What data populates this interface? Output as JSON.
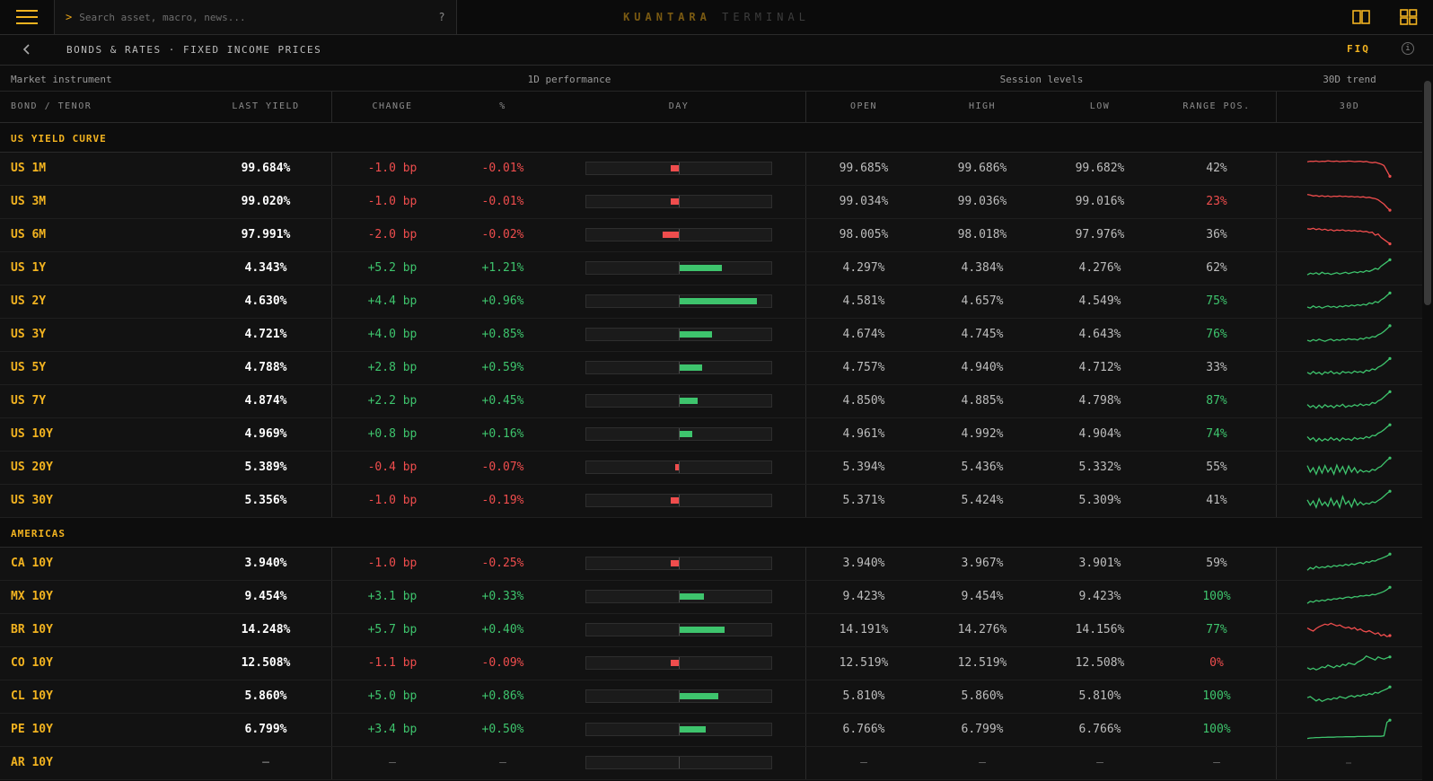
{
  "app": {
    "brand_primary": "KUANTARA",
    "brand_secondary": "TERMINAL",
    "search_placeholder": "Search asset, macro, news...",
    "search_prompt": ">",
    "help_label": "?",
    "breadcrumb": "BONDS & RATES · FIXED INCOME PRICES",
    "function_code": "FIQ",
    "accent_color": "#f2b320"
  },
  "table": {
    "group_headers": [
      "Market instrument",
      "1D performance",
      "Session levels",
      "30D trend"
    ],
    "columns": [
      "BOND / TENOR",
      "LAST YIELD",
      "CHANGE",
      "%",
      "DAY",
      "OPEN",
      "HIGH",
      "LOW",
      "RANGE POS.",
      "30D"
    ],
    "sections": [
      {
        "title": "US YIELD CURVE",
        "rows": [
          {
            "name": "US 1M",
            "last": "99.684%",
            "change": "-1.0 bp",
            "pct": "-0.01%",
            "day": -0.05,
            "open": "99.685%",
            "high": "99.686%",
            "low": "99.682%",
            "range": "42%",
            "range_tone": "neutral",
            "trend": "down",
            "spark": [
              0.82,
              0.85,
              0.84,
              0.86,
              0.83,
              0.85,
              0.84,
              0.87,
              0.85,
              0.84,
              0.86,
              0.83,
              0.85,
              0.84,
              0.86,
              0.85,
              0.83,
              0.84,
              0.85,
              0.82,
              0.84,
              0.8,
              0.78,
              0.8,
              0.76,
              0.72,
              0.65,
              0.4,
              0.15
            ]
          },
          {
            "name": "US 3M",
            "last": "99.020%",
            "change": "-1.0 bp",
            "pct": "-0.01%",
            "day": -0.05,
            "open": "99.034%",
            "high": "99.036%",
            "low": "99.016%",
            "range": "23%",
            "range_tone": "neg",
            "trend": "down",
            "spark": [
              0.85,
              0.82,
              0.78,
              0.8,
              0.76,
              0.79,
              0.75,
              0.78,
              0.74,
              0.77,
              0.76,
              0.78,
              0.75,
              0.77,
              0.74,
              0.76,
              0.73,
              0.75,
              0.72,
              0.74,
              0.7,
              0.72,
              0.68,
              0.66,
              0.6,
              0.5,
              0.4,
              0.25,
              0.12
            ]
          },
          {
            "name": "US 6M",
            "last": "97.991%",
            "change": "-2.0 bp",
            "pct": "-0.02%",
            "day": -0.1,
            "open": "98.005%",
            "high": "98.018%",
            "low": "97.976%",
            "range": "36%",
            "range_tone": "neutral",
            "trend": "down",
            "spark": [
              0.8,
              0.78,
              0.82,
              0.76,
              0.8,
              0.74,
              0.78,
              0.72,
              0.76,
              0.7,
              0.74,
              0.72,
              0.75,
              0.7,
              0.73,
              0.69,
              0.72,
              0.68,
              0.7,
              0.66,
              0.68,
              0.62,
              0.64,
              0.5,
              0.56,
              0.4,
              0.3,
              0.2,
              0.1
            ]
          },
          {
            "name": "US 1Y",
            "last": "4.343%",
            "change": "+5.2 bp",
            "pct": "+1.21%",
            "day": 0.26,
            "open": "4.297%",
            "high": "4.384%",
            "low": "4.276%",
            "range": "62%",
            "range_tone": "neutral",
            "trend": "up",
            "spark": [
              0.2,
              0.28,
              0.24,
              0.3,
              0.22,
              0.32,
              0.25,
              0.28,
              0.22,
              0.26,
              0.3,
              0.24,
              0.28,
              0.32,
              0.26,
              0.3,
              0.34,
              0.3,
              0.36,
              0.32,
              0.4,
              0.36,
              0.42,
              0.5,
              0.46,
              0.6,
              0.7,
              0.8,
              0.9
            ]
          },
          {
            "name": "US 2Y",
            "last": "4.630%",
            "change": "+4.4 bp",
            "pct": "+0.96%",
            "day": 0.48,
            "open": "4.581%",
            "high": "4.657%",
            "low": "4.549%",
            "range": "75%",
            "range_tone": "pos",
            "trend": "up",
            "spark": [
              0.25,
              0.2,
              0.3,
              0.22,
              0.28,
              0.2,
              0.26,
              0.3,
              0.24,
              0.28,
              0.22,
              0.3,
              0.26,
              0.32,
              0.28,
              0.34,
              0.3,
              0.36,
              0.32,
              0.38,
              0.34,
              0.44,
              0.4,
              0.5,
              0.46,
              0.58,
              0.66,
              0.78,
              0.9
            ]
          },
          {
            "name": "US 3Y",
            "last": "4.721%",
            "change": "+4.0 bp",
            "pct": "+0.85%",
            "day": 0.2,
            "open": "4.674%",
            "high": "4.745%",
            "low": "4.643%",
            "range": "76%",
            "range_tone": "pos",
            "trend": "up",
            "spark": [
              0.25,
              0.2,
              0.28,
              0.22,
              0.3,
              0.24,
              0.2,
              0.26,
              0.3,
              0.22,
              0.28,
              0.24,
              0.3,
              0.26,
              0.32,
              0.28,
              0.3,
              0.26,
              0.34,
              0.3,
              0.38,
              0.34,
              0.42,
              0.4,
              0.5,
              0.56,
              0.66,
              0.78,
              0.92
            ]
          },
          {
            "name": "US 5Y",
            "last": "4.788%",
            "change": "+2.8 bp",
            "pct": "+0.59%",
            "day": 0.14,
            "open": "4.757%",
            "high": "4.940%",
            "low": "4.712%",
            "range": "33%",
            "range_tone": "neutral",
            "trend": "up",
            "spark": [
              0.3,
              0.22,
              0.34,
              0.24,
              0.3,
              0.2,
              0.32,
              0.26,
              0.36,
              0.24,
              0.3,
              0.22,
              0.34,
              0.28,
              0.32,
              0.26,
              0.36,
              0.3,
              0.34,
              0.28,
              0.4,
              0.36,
              0.46,
              0.42,
              0.54,
              0.6,
              0.7,
              0.82,
              0.94
            ]
          },
          {
            "name": "US 7Y",
            "last": "4.874%",
            "change": "+2.2 bp",
            "pct": "+0.45%",
            "day": 0.11,
            "open": "4.850%",
            "high": "4.885%",
            "low": "4.798%",
            "range": "87%",
            "range_tone": "pos",
            "trend": "up",
            "spark": [
              0.35,
              0.22,
              0.3,
              0.18,
              0.32,
              0.2,
              0.34,
              0.24,
              0.3,
              0.2,
              0.32,
              0.26,
              0.36,
              0.22,
              0.3,
              0.26,
              0.34,
              0.28,
              0.38,
              0.3,
              0.36,
              0.32,
              0.44,
              0.4,
              0.52,
              0.58,
              0.7,
              0.82,
              0.94
            ]
          },
          {
            "name": "US 10Y",
            "last": "4.969%",
            "change": "+0.8 bp",
            "pct": "+0.16%",
            "day": 0.08,
            "open": "4.961%",
            "high": "4.992%",
            "low": "4.904%",
            "range": "74%",
            "range_tone": "pos",
            "trend": "up",
            "spark": [
              0.4,
              0.25,
              0.35,
              0.18,
              0.32,
              0.2,
              0.3,
              0.22,
              0.36,
              0.24,
              0.32,
              0.2,
              0.34,
              0.26,
              0.3,
              0.22,
              0.36,
              0.28,
              0.34,
              0.3,
              0.4,
              0.34,
              0.46,
              0.44,
              0.56,
              0.62,
              0.72,
              0.84,
              0.95
            ]
          },
          {
            "name": "US 20Y",
            "last": "5.389%",
            "change": "-0.4 bp",
            "pct": "-0.07%",
            "day": -0.02,
            "open": "5.394%",
            "high": "5.436%",
            "low": "5.332%",
            "range": "55%",
            "range_tone": "neutral",
            "trend": "up",
            "spark": [
              0.6,
              0.3,
              0.5,
              0.2,
              0.55,
              0.25,
              0.6,
              0.3,
              0.5,
              0.2,
              0.62,
              0.3,
              0.55,
              0.22,
              0.58,
              0.3,
              0.5,
              0.26,
              0.4,
              0.3,
              0.36,
              0.3,
              0.42,
              0.38,
              0.5,
              0.56,
              0.7,
              0.84,
              0.95
            ]
          },
          {
            "name": "US 30Y",
            "last": "5.356%",
            "change": "-1.0 bp",
            "pct": "-0.19%",
            "day": -0.05,
            "open": "5.371%",
            "high": "5.424%",
            "low": "5.309%",
            "range": "41%",
            "range_tone": "neutral",
            "trend": "up",
            "spark": [
              0.55,
              0.3,
              0.5,
              0.2,
              0.6,
              0.3,
              0.45,
              0.25,
              0.62,
              0.3,
              0.52,
              0.2,
              0.7,
              0.35,
              0.5,
              0.22,
              0.58,
              0.3,
              0.45,
              0.32,
              0.4,
              0.36,
              0.46,
              0.42,
              0.52,
              0.6,
              0.72,
              0.84,
              0.95
            ]
          }
        ]
      },
      {
        "title": "AMERICAS",
        "rows": [
          {
            "name": "CA 10Y",
            "last": "3.940%",
            "change": "-1.0 bp",
            "pct": "-0.25%",
            "day": -0.05,
            "open": "3.940%",
            "high": "3.967%",
            "low": "3.901%",
            "range": "59%",
            "range_tone": "neutral",
            "trend": "up",
            "spark": [
              0.2,
              0.32,
              0.26,
              0.38,
              0.3,
              0.36,
              0.32,
              0.4,
              0.34,
              0.42,
              0.38,
              0.44,
              0.4,
              0.48,
              0.42,
              0.5,
              0.46,
              0.52,
              0.56,
              0.5,
              0.6,
              0.56,
              0.64,
              0.62,
              0.7,
              0.74,
              0.8,
              0.86,
              0.95
            ]
          },
          {
            "name": "MX 10Y",
            "last": "9.454%",
            "change": "+3.1 bp",
            "pct": "+0.33%",
            "day": 0.15,
            "open": "9.423%",
            "high": "9.454%",
            "low": "9.423%",
            "range": "100%",
            "range_tone": "pos",
            "trend": "up",
            "spark": [
              0.2,
              0.3,
              0.26,
              0.34,
              0.3,
              0.36,
              0.32,
              0.4,
              0.36,
              0.42,
              0.4,
              0.46,
              0.42,
              0.48,
              0.5,
              0.46,
              0.52,
              0.5,
              0.56,
              0.54,
              0.58,
              0.56,
              0.62,
              0.6,
              0.66,
              0.7,
              0.76,
              0.84,
              0.95
            ]
          },
          {
            "name": "BR 10Y",
            "last": "14.248%",
            "change": "+5.7 bp",
            "pct": "+0.40%",
            "day": 0.28,
            "open": "14.191%",
            "high": "14.276%",
            "low": "14.156%",
            "range": "77%",
            "range_tone": "pos",
            "trend": "down",
            "spark": [
              0.6,
              0.52,
              0.46,
              0.58,
              0.66,
              0.72,
              0.78,
              0.74,
              0.82,
              0.76,
              0.7,
              0.74,
              0.66,
              0.6,
              0.64,
              0.56,
              0.62,
              0.5,
              0.56,
              0.46,
              0.42,
              0.48,
              0.4,
              0.32,
              0.38,
              0.24,
              0.3,
              0.2,
              0.25
            ]
          },
          {
            "name": "CO 10Y",
            "last": "12.508%",
            "change": "-1.1 bp",
            "pct": "-0.09%",
            "day": -0.05,
            "open": "12.519%",
            "high": "12.519%",
            "low": "12.508%",
            "range": "0%",
            "range_tone": "neg",
            "trend": "up",
            "spark": [
              0.3,
              0.22,
              0.28,
              0.2,
              0.26,
              0.34,
              0.3,
              0.42,
              0.36,
              0.3,
              0.4,
              0.34,
              0.46,
              0.4,
              0.52,
              0.48,
              0.44,
              0.56,
              0.62,
              0.7,
              0.84,
              0.78,
              0.72,
              0.66,
              0.8,
              0.74,
              0.7,
              0.76,
              0.8
            ]
          },
          {
            "name": "CL 10Y",
            "last": "5.860%",
            "change": "+5.0 bp",
            "pct": "+0.86%",
            "day": 0.24,
            "open": "5.810%",
            "high": "5.860%",
            "low": "5.810%",
            "range": "100%",
            "range_tone": "pos",
            "trend": "up",
            "spark": [
              0.45,
              0.5,
              0.4,
              0.3,
              0.38,
              0.28,
              0.34,
              0.4,
              0.36,
              0.44,
              0.4,
              0.5,
              0.46,
              0.42,
              0.5,
              0.54,
              0.48,
              0.56,
              0.52,
              0.6,
              0.56,
              0.64,
              0.6,
              0.7,
              0.66,
              0.74,
              0.8,
              0.86,
              0.95
            ]
          },
          {
            "name": "PE 10Y",
            "last": "6.799%",
            "change": "+3.4 bp",
            "pct": "+0.50%",
            "day": 0.16,
            "open": "6.766%",
            "high": "6.799%",
            "low": "6.766%",
            "range": "100%",
            "range_tone": "pos",
            "trend": "up",
            "spark": [
              0.1,
              0.12,
              0.13,
              0.14,
              0.14,
              0.15,
              0.15,
              0.16,
              0.16,
              0.16,
              0.17,
              0.17,
              0.17,
              0.18,
              0.18,
              0.18,
              0.18,
              0.19,
              0.19,
              0.19,
              0.19,
              0.2,
              0.2,
              0.2,
              0.2,
              0.2,
              0.22,
              0.85,
              0.95
            ]
          },
          {
            "name": "AR 10Y",
            "last": "—",
            "change": "—",
            "pct": "—",
            "day": null,
            "open": "—",
            "high": "—",
            "low": "—",
            "range": "—",
            "range_tone": "dash",
            "trend": "flat",
            "spark": null
          }
        ]
      }
    ]
  },
  "colors": {
    "up": "#3ec46d",
    "down": "#ef4d4d",
    "neutral": "#bdbdbd",
    "accent": "#f2b320"
  }
}
